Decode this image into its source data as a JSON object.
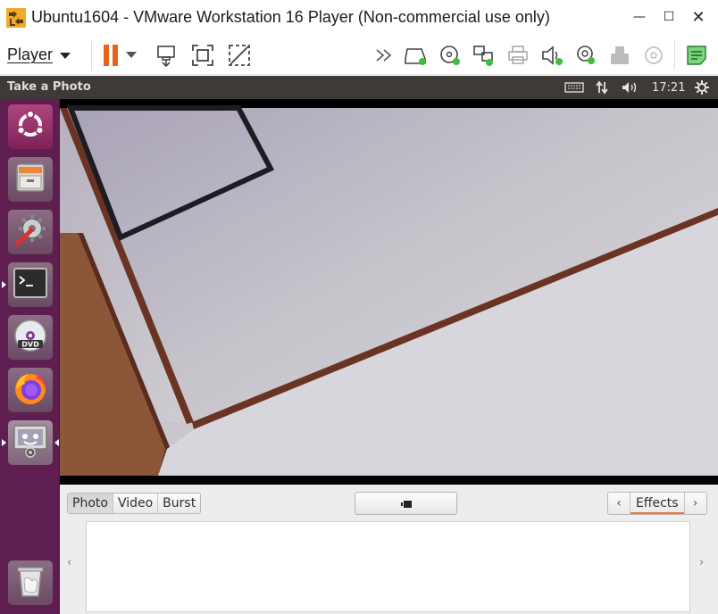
{
  "window": {
    "title": "Ubuntu1604 - VMware Workstation 16 Player (Non-commercial use only)",
    "minimize": "—",
    "maximize": "☐",
    "close": "✕"
  },
  "toolbar": {
    "player_label": "Player",
    "icons": [
      "pause-icon",
      "send-ctrl-alt-del-icon",
      "full-screen-icon",
      "unity-icon",
      "more-devices-icon",
      "hard-disk-icon",
      "cd-dvd-icon",
      "network-adapter-icon",
      "printer-icon",
      "sound-card-icon",
      "camera-device-icon",
      "usb-device-icon",
      "disc-icon",
      "notes-icon"
    ],
    "accent_color": "#e8641a"
  },
  "ubuntu_panel": {
    "app_title": "Take a Photo",
    "clock": "17:21"
  },
  "launcher": {
    "items": [
      "ubuntu-dash",
      "files",
      "system-settings",
      "terminal",
      "dvd",
      "firefox",
      "cheese",
      "trash"
    ],
    "background": "#5e1e4f"
  },
  "cheese": {
    "modes": [
      "Photo",
      "Video",
      "Burst"
    ],
    "active_mode": "Photo",
    "effects_label": "Effects",
    "prev_arrow": "‹",
    "next_arrow": "›",
    "thumb_prev": "‹",
    "thumb_next": "›"
  }
}
